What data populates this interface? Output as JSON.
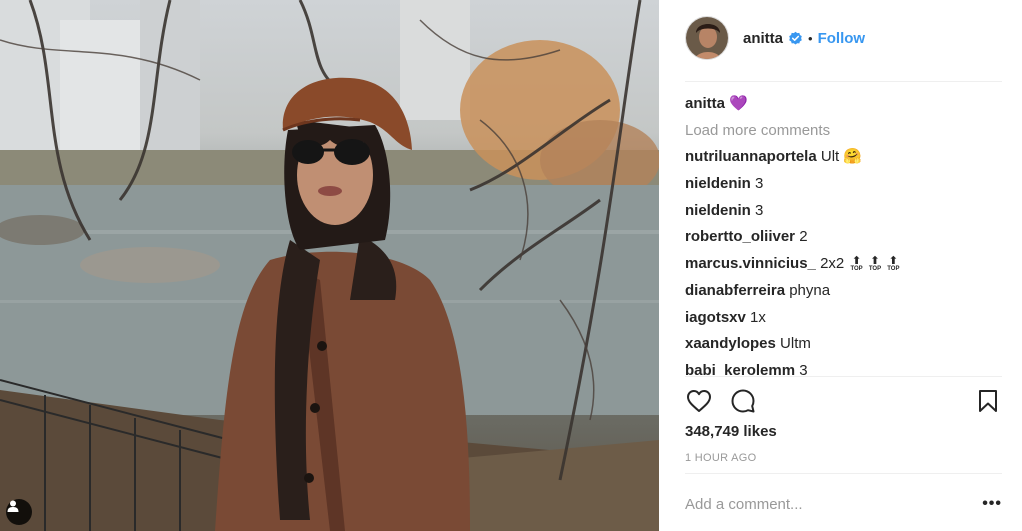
{
  "post": {
    "username": "anitta",
    "follow_label": "Follow",
    "separator": "•",
    "likes": "348,749 likes",
    "time": "1 HOUR AGO",
    "add_comment_placeholder": "Add a comment...",
    "more_label": "•••"
  },
  "caption": {
    "user": "anitta",
    "text": "💜"
  },
  "load_more": "Load more comments",
  "comments": [
    {
      "user": "nutriluannaportela",
      "text": "Ult 🤗"
    },
    {
      "user": "nieldenin",
      "text": "3"
    },
    {
      "user": "nieldenin",
      "text": "3"
    },
    {
      "user": "robertto_oliiver",
      "text": "2"
    },
    {
      "user": "marcus.vinnicius_",
      "text": "2x2",
      "top_emoji_label": "TOP"
    },
    {
      "user": "dianabferreira",
      "text": "phyna"
    },
    {
      "user": "iagotsxv",
      "text": "1x"
    },
    {
      "user": "xaandylopes",
      "text": "Ultm"
    },
    {
      "user": "babi_kerolemm",
      "text": "3"
    }
  ],
  "icons": {
    "like": "heart-icon",
    "comment": "comment-icon",
    "save": "bookmark-icon",
    "verified": "verified-badge-icon",
    "tag": "user-tag-icon"
  },
  "colors": {
    "link": "#3897f0",
    "text": "#262626",
    "muted": "#999999",
    "divider": "#efefef"
  }
}
